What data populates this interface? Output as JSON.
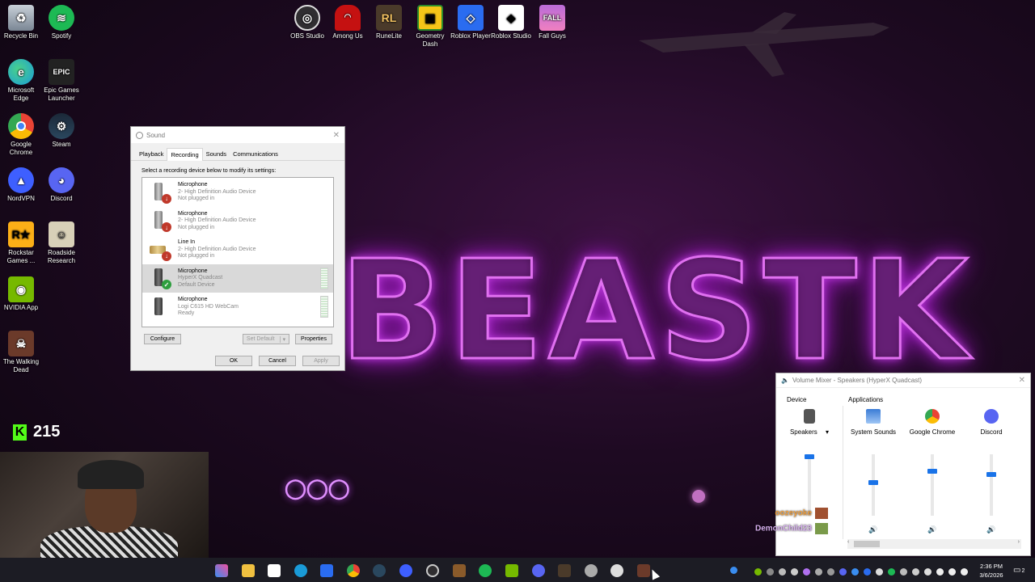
{
  "desktop": {
    "icons": [
      {
        "label": "Recycle Bin",
        "icon": "recycle-bin-icon",
        "color": "#9aa6b2"
      },
      {
        "label": "Spotify",
        "icon": "spotify-icon",
        "color": "#1db954"
      },
      {
        "label": "Microsoft Edge",
        "icon": "edge-icon",
        "color": "#1a9bd8"
      },
      {
        "label": "Epic Games Launcher",
        "icon": "epic-games-icon",
        "color": "#222222"
      },
      {
        "label": "Google Chrome",
        "icon": "chrome-icon",
        "color": "#ea4335"
      },
      {
        "label": "Steam",
        "icon": "steam-icon",
        "color": "#1b2838"
      },
      {
        "label": "NordVPN",
        "icon": "nordvpn-icon",
        "color": "#3e5fff"
      },
      {
        "label": "Discord",
        "icon": "discord-icon",
        "color": "#5865f2"
      },
      {
        "label": "Rockstar Games ...",
        "icon": "rockstar-icon",
        "color": "#fcaf17"
      },
      {
        "label": "Roadside Research",
        "icon": "roadside-research-icon",
        "color": "#d8d0b8"
      },
      {
        "label": "NVIDIA App",
        "icon": "nvidia-icon",
        "color": "#76b900"
      },
      {
        "label": "The Walking Dead",
        "icon": "walking-dead-icon",
        "color": "#6b3a2a"
      },
      {
        "label": "OBS Studio",
        "icon": "obs-icon",
        "color": "#302e31"
      },
      {
        "label": "Among Us",
        "icon": "among-us-icon",
        "color": "#c51111"
      },
      {
        "label": "RuneLite",
        "icon": "runelite-icon",
        "color": "#4a3a2a"
      },
      {
        "label": "Geometry Dash",
        "icon": "geometry-dash-icon",
        "color": "#f5c518"
      },
      {
        "label": "Roblox Player",
        "icon": "roblox-player-icon",
        "color": "#2a6cf0"
      },
      {
        "label": "Roblox Studio",
        "icon": "roblox-studio-icon",
        "color": "#ffffff"
      },
      {
        "label": "Fall Guys",
        "icon": "fall-guys-icon",
        "color": "#b96bd8"
      }
    ]
  },
  "wallpaper": {
    "brand": "BEASTK"
  },
  "sound_dialog": {
    "title": "Sound",
    "tabs": [
      "Playback",
      "Recording",
      "Sounds",
      "Communications"
    ],
    "active_tab": "Recording",
    "instruction": "Select a recording device below to modify its settings:",
    "devices": [
      {
        "name": "Microphone",
        "detail": "2- High Definition Audio Device",
        "status": "Not plugged in",
        "badge": "unplugged"
      },
      {
        "name": "Microphone",
        "detail": "2- High Definition Audio Device",
        "status": "Not plugged in",
        "badge": "unplugged"
      },
      {
        "name": "Line In",
        "detail": "2- High Definition Audio Device",
        "status": "Not plugged in",
        "badge": "unplugged"
      },
      {
        "name": "Microphone",
        "detail": "HyperX Quadcast",
        "status": "Default Device",
        "badge": "default"
      },
      {
        "name": "Microphone",
        "detail": "Logi C615 HD WebCam",
        "status": "Ready",
        "badge": "none"
      }
    ],
    "buttons": {
      "configure": "Configure",
      "set_default": "Set Default",
      "properties": "Properties",
      "ok": "OK",
      "cancel": "Cancel",
      "apply": "Apply"
    }
  },
  "volume_mixer": {
    "title": "Volume Mixer - Speakers (HyperX Quadcast)",
    "device_header": "Device",
    "apps_header": "Applications",
    "columns": [
      {
        "label": "Speakers",
        "icon": "speaker-device-icon",
        "level": 1.0
      },
      {
        "label": "System Sounds",
        "icon": "system-sounds-icon",
        "level": 0.55
      },
      {
        "label": "Google Chrome",
        "icon": "chrome-icon",
        "level": 0.75
      },
      {
        "label": "Discord",
        "icon": "discord-icon",
        "level": 0.68
      }
    ]
  },
  "stream": {
    "kick_count": "215",
    "chat": [
      {
        "user": "oozeyoke",
        "color": "#f0a040"
      },
      {
        "user": "DemonChild23",
        "color": "#d8b0f0"
      }
    ]
  },
  "taskbar": {
    "clock_time": "2:36 PM",
    "clock_date": "3/6/2026",
    "notification_count": "2"
  }
}
